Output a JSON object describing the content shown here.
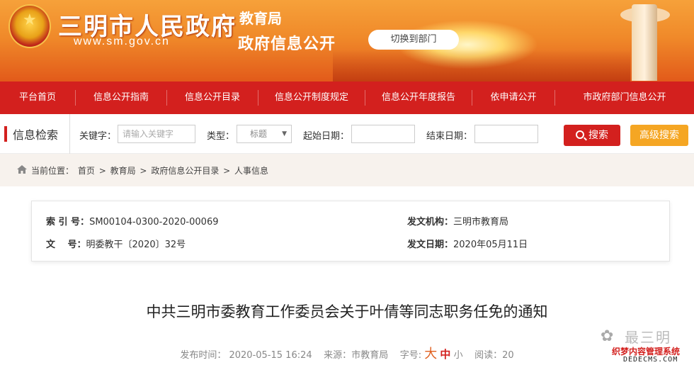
{
  "header": {
    "site_title": "三明市人民政府",
    "site_url": "www.sm.gov.cn",
    "department": "教育局",
    "gov_info_title": "政府信息公开",
    "switch_label": "切换到部门"
  },
  "nav": {
    "items": [
      "平台首页",
      "信息公开指南",
      "信息公开目录",
      "信息公开制度规定",
      "信息公开年度报告",
      "依申请公开",
      "市政府部门信息公开"
    ]
  },
  "search": {
    "title": "信息检索",
    "keyword_label": "关键字：",
    "keyword_placeholder": "请输入关键字",
    "type_label": "类型：",
    "type_value": "标题",
    "start_label": "起始日期：",
    "end_label": "结束日期：",
    "search_button": "搜索",
    "advanced_button": "高级搜索"
  },
  "breadcrumb": {
    "prefix": "当前位置：",
    "items": [
      "首页",
      "教育局",
      "政府信息公开目录",
      "人事信息"
    ],
    "separator": ">"
  },
  "info": {
    "index_label": "索 引 号：",
    "index_value": "SM00104-0300-2020-00069",
    "doc_label": "文　 号：",
    "doc_value": "明委教干〔2020〕32号",
    "issuer_label": "发文机构：",
    "issuer_value": "三明市教育局",
    "date_label": "发文日期：",
    "date_value": "2020年05月11日"
  },
  "article": {
    "title": "中共三明市委教育工作委员会关于叶倩等同志职务任免的通知",
    "published_label": "发布时间：",
    "published_value": "2020-05-15 16:24",
    "source_label": "来源：",
    "source_value": "市教育局",
    "font_label": "字号:",
    "font_large": "大",
    "font_medium": "中",
    "font_small": "小",
    "reads_label": "阅读：",
    "reads_value": "20"
  },
  "watermark": {
    "name": "最三明",
    "system": "织梦内容管理系统",
    "url": "DEDECMS.COM"
  },
  "colors": {
    "brand_red": "#d3201e",
    "accent_orange": "#f5a623",
    "breadcrumb_bg": "#f7f2ed"
  }
}
